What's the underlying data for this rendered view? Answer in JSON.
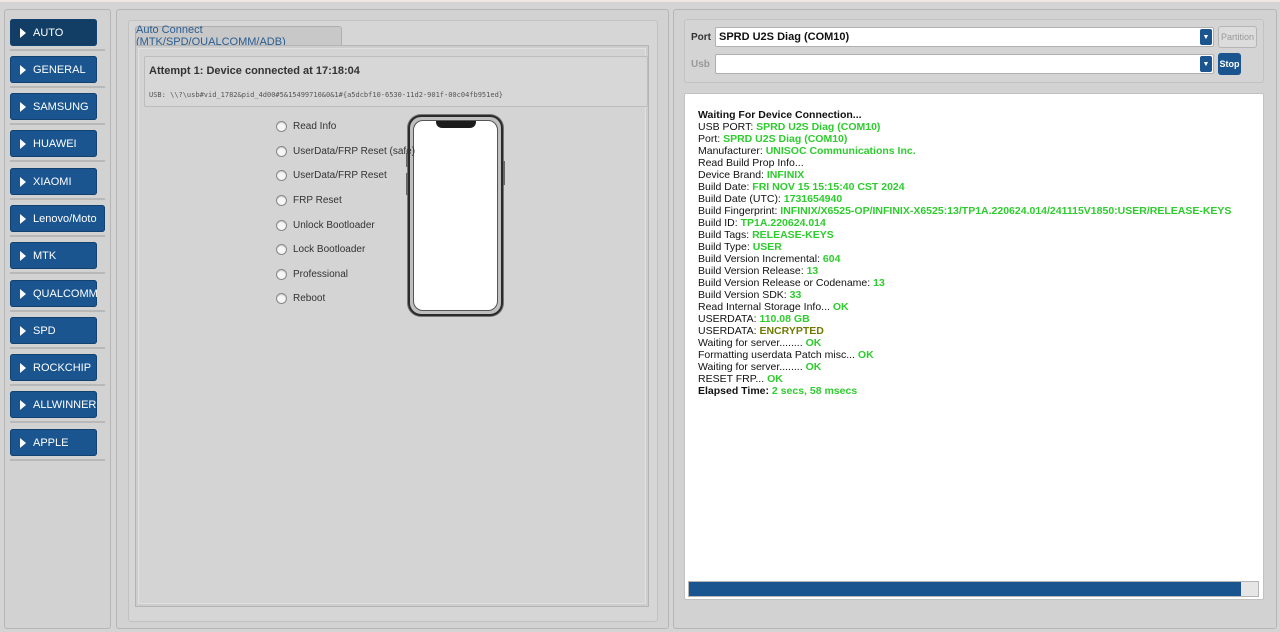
{
  "sidebar": {
    "items": [
      {
        "label": "AUTO",
        "active": true
      },
      {
        "label": "GENERAL"
      },
      {
        "label": "SAMSUNG"
      },
      {
        "label": "HUAWEI"
      },
      {
        "label": "XIAOMI"
      },
      {
        "label": "Lenovo/Moto"
      },
      {
        "label": "MTK"
      },
      {
        "label": "QUALCOMM"
      },
      {
        "label": "SPD"
      },
      {
        "label": "ROCKCHIP"
      },
      {
        "label": "ALLWINNER"
      },
      {
        "label": "APPLE"
      }
    ]
  },
  "tab": {
    "label": "Auto Connect (MTK/SPD/QUALCOMM/ADB)"
  },
  "status": {
    "title": "Attempt 1: Device connected at 17:18:04",
    "usb": "USB: \\\\?\\usb#vid_1782&pid_4d00#5&15499710&0&1#{a5dcbf10-6530-11d2-901f-00c04fb951ed}"
  },
  "options": [
    "Read Info",
    "UserData/FRP Reset (safe)",
    "UserData/FRP Reset",
    "FRP Reset",
    "Unlock Bootloader",
    "Lock Bootloader",
    "Professional",
    "Reboot"
  ],
  "port": {
    "label": "Port",
    "value": "SPRD U2S Diag (COM10)",
    "partition_label": "Partition"
  },
  "usb": {
    "label": "Usb",
    "value": "",
    "stop_label": "Stop"
  },
  "log": [
    {
      "k": "Waiting For Device Connection...",
      "bold": true
    },
    {
      "k": "USB PORT: ",
      "v": "SPRD U2S Diag (COM10)"
    },
    {
      "k": "Port: ",
      "v": "SPRD U2S Diag (COM10)"
    },
    {
      "k": "Manufacturer: ",
      "v": "UNISOC Communications Inc."
    },
    {
      "k": "Read Build Prop Info..."
    },
    {
      "k": " Device Brand: ",
      "v": "INFINIX"
    },
    {
      "k": " Build Date: ",
      "v": "FRI NOV 15 15:15:40 CST 2024"
    },
    {
      "k": " Build Date (UTC): ",
      "v": "1731654940"
    },
    {
      "k": " Build Fingerprint: ",
      "v": "INFINIX/X6525-OP/INFINIX-X6525:13/TP1A.220624.014/241115V1850:USER/RELEASE-KEYS"
    },
    {
      "k": " Build ID: ",
      "v": "TP1A.220624.014"
    },
    {
      "k": " Build Tags: ",
      "v": "RELEASE-KEYS"
    },
    {
      "k": " Build Type: ",
      "v": "USER"
    },
    {
      "k": " Build Version Incremental: ",
      "v": "604"
    },
    {
      "k": " Build Version Release: ",
      "v": "13"
    },
    {
      "k": " Build Version Release or Codename: ",
      "v": "13"
    },
    {
      "k": " Build Version SDK: ",
      "v": "33"
    },
    {
      "k": "Read Internal Storage Info... ",
      "v": "OK"
    },
    {
      "k": "USERDATA: ",
      "v": "110.08 GB"
    },
    {
      "k": "USERDATA: ",
      "v": "ENCRYPTED",
      "warn": true
    },
    {
      "k": "Waiting for server........ ",
      "v": "OK"
    },
    {
      "k": "Formatting userdata Patch misc... ",
      "v": "OK"
    },
    {
      "k": "Waiting for server........ ",
      "v": "OK"
    },
    {
      "k": "RESET FRP... ",
      "v": "OK"
    },
    {
      "k": "Elapsed Time: ",
      "v": "2 secs, 58 msecs",
      "bold": true
    }
  ],
  "progress": {
    "fraction": 0.97
  },
  "colors": {
    "accent": "#1a5590",
    "ok": "#2ecc2e",
    "warn": "#6f7a00"
  }
}
